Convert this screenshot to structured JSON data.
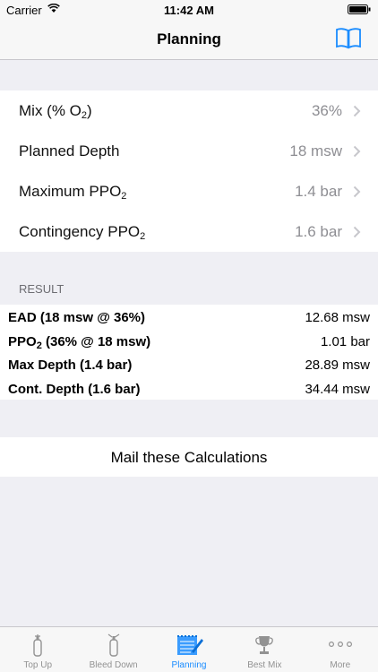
{
  "status": {
    "carrier": "Carrier",
    "time": "11:42 AM"
  },
  "nav": {
    "title": "Planning"
  },
  "inputs": [
    {
      "label_pre": "Mix (% O",
      "label_sub": "2",
      "label_post": ")",
      "value": "36%"
    },
    {
      "label_pre": "Planned Depth",
      "label_sub": "",
      "label_post": "",
      "value": "18 msw"
    },
    {
      "label_pre": "Maximum PPO",
      "label_sub": "2",
      "label_post": "",
      "value": "1.4 bar"
    },
    {
      "label_pre": "Contingency PPO",
      "label_sub": "2",
      "label_post": "",
      "value": "1.6 bar"
    }
  ],
  "result": {
    "header": "RESULT",
    "rows": [
      {
        "label_pre": "EAD (18 msw @ 36%)",
        "label_sub": "",
        "label_post": "",
        "value": "12.68 msw"
      },
      {
        "label_pre": "PPO",
        "label_sub": "2",
        "label_post": " (36% @ 18 msw)",
        "value": "1.01 bar"
      },
      {
        "label_pre": "Max Depth (1.4 bar)",
        "label_sub": "",
        "label_post": "",
        "value": "28.89 msw"
      },
      {
        "label_pre": "Cont. Depth (1.6 bar)",
        "label_sub": "",
        "label_post": "",
        "value": "34.44 msw"
      }
    ]
  },
  "mail": {
    "label": "Mail these Calculations"
  },
  "tabs": [
    {
      "label": "Top Up",
      "icon": "tank-icon"
    },
    {
      "label": "Bleed Down",
      "icon": "bleed-tank-icon"
    },
    {
      "label": "Planning",
      "icon": "notepad-icon"
    },
    {
      "label": "Best Mix",
      "icon": "trophy-icon"
    },
    {
      "label": "More",
      "icon": "more-icon"
    }
  ],
  "colors": {
    "accent": "#1a8cff",
    "muted": "#8e8e93",
    "background": "#efeff4"
  }
}
